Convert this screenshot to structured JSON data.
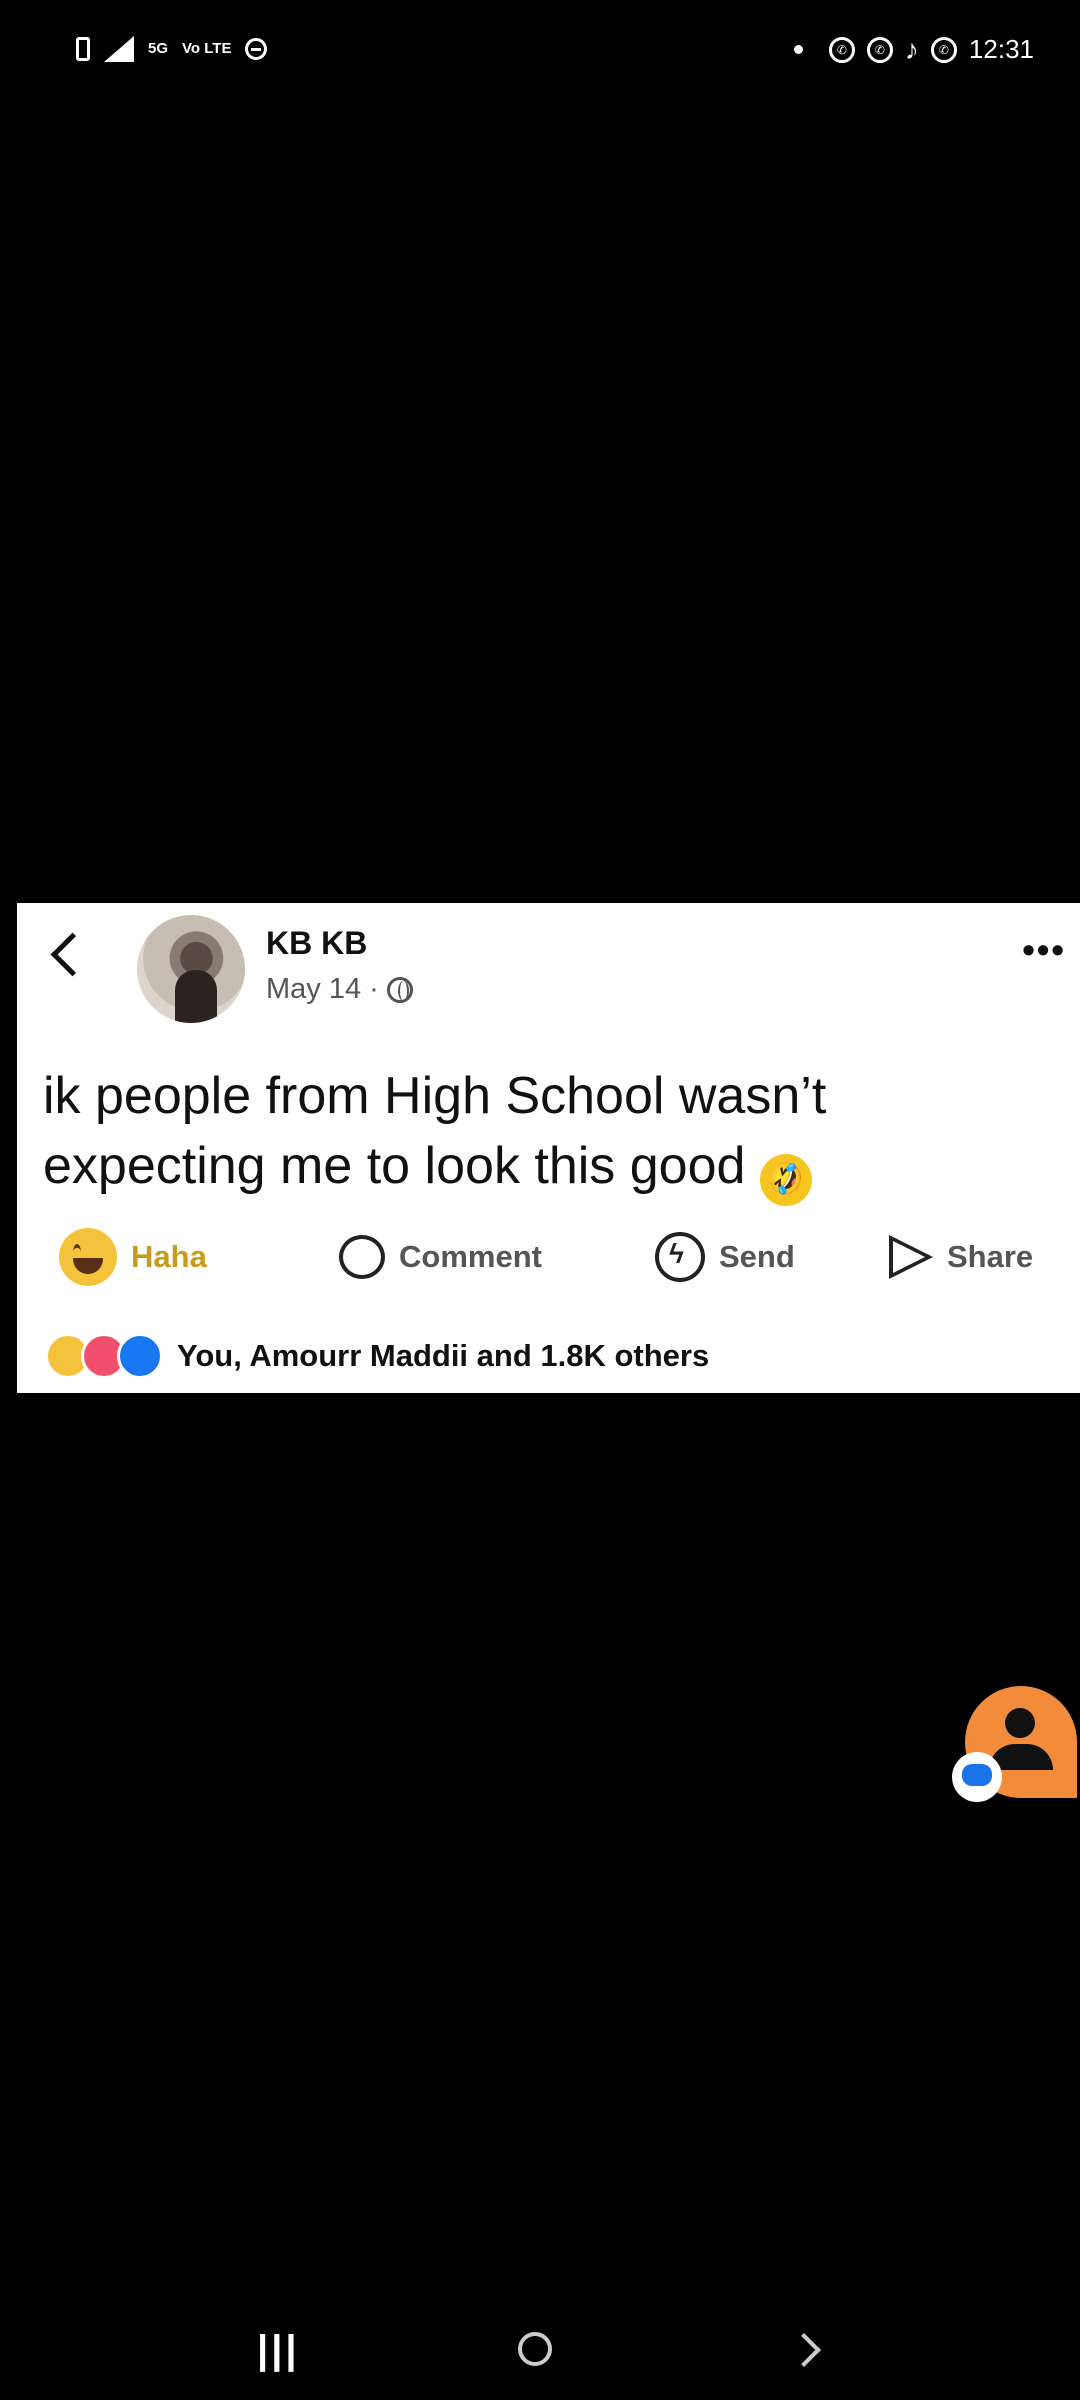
{
  "status_bar": {
    "network_label": "5G",
    "volte_label": "Vo LTE",
    "time": "12:31",
    "icons": [
      "battery-icon",
      "signal-icon",
      "dnd-icon",
      "notification-dot",
      "whatsapp-icon",
      "whatsapp-icon",
      "tiktok-icon",
      "whatsapp-icon"
    ]
  },
  "post": {
    "author": "KB KB",
    "date": "May 14 ·",
    "text": "ik people from High School wasn’t expecting me to look this good",
    "text_emoji": "🤣",
    "actions": {
      "haha": "Haha",
      "comment": "Comment",
      "send": "Send",
      "share": "Share"
    },
    "reactions_text": "You, Amourr Maddii and 1.8K others"
  },
  "nav": {
    "recent_glyph": "|||"
  },
  "colors": {
    "background": "#000000",
    "card": "#ffffff",
    "haha": "#c99a1b",
    "bubble": "#f28b3a"
  }
}
